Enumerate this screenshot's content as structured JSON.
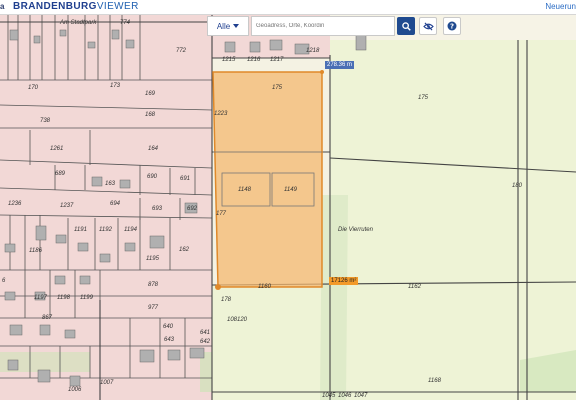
{
  "header": {
    "prefix": "a",
    "brand_bold": "BRANDENBURG",
    "brand_thin": "VIEWER",
    "news_link": "Neuerun"
  },
  "search": {
    "scope_label": "Alle",
    "placeholder": "Geoadress, Orte, Koordin"
  },
  "icons": {
    "search": "search-icon",
    "layers_off": "eye-off-icon",
    "help": "help-icon",
    "dropdown": "chevron-down-icon"
  },
  "measurements": {
    "length": "278.36 m",
    "area": "17126 m²"
  },
  "parcel_labels": {
    "p774": "774",
    "p772": "772",
    "p1215": "1215",
    "p1216": "1216",
    "p1217": "1217",
    "p1218": "1218",
    "p170": "170",
    "p173": "173",
    "p175a": "175",
    "p175b": "175",
    "p169": "169",
    "p738": "738",
    "p1223": "1223",
    "p168": "168",
    "p1261": "1261",
    "p164": "164",
    "p689": "689",
    "p690": "690",
    "p691": "691",
    "p163": "163",
    "p1148": "1148",
    "p1149": "1149",
    "p180": "180",
    "p1236": "1236",
    "p1237": "1237",
    "p694": "694",
    "p693": "693",
    "p692": "692",
    "p177": "177",
    "p1191": "1191",
    "p1192": "1192",
    "p1194": "1194",
    "p1186": "1186",
    "p1195": "1195",
    "p162": "162",
    "p6": "6",
    "p1197": "1197",
    "p1198": "1198",
    "p1199": "1199",
    "p878": "878",
    "p1160": "1160",
    "p1162": "1162",
    "p178": "178",
    "p977": "977",
    "p108120": "108120",
    "p867": "867",
    "p640": "640",
    "p641": "641",
    "p642": "642",
    "p643": "643",
    "p1007": "1007",
    "p1006": "1006",
    "p1168": "1168",
    "p1045": "1045",
    "p1046": "1046",
    "p1047": "1047",
    "street": "Am Stadtpark",
    "field_name": "Die Vierruten"
  },
  "colors": {
    "accent": "#1f4a8f",
    "parcel_pink": "#f2d8d8",
    "field_green": "#eef2d8",
    "selection_fill": "#f4b870",
    "selection_stroke": "#e0892a",
    "area_label_bg": "#f39a2a",
    "length_label_bg": "#4a6fb5"
  }
}
